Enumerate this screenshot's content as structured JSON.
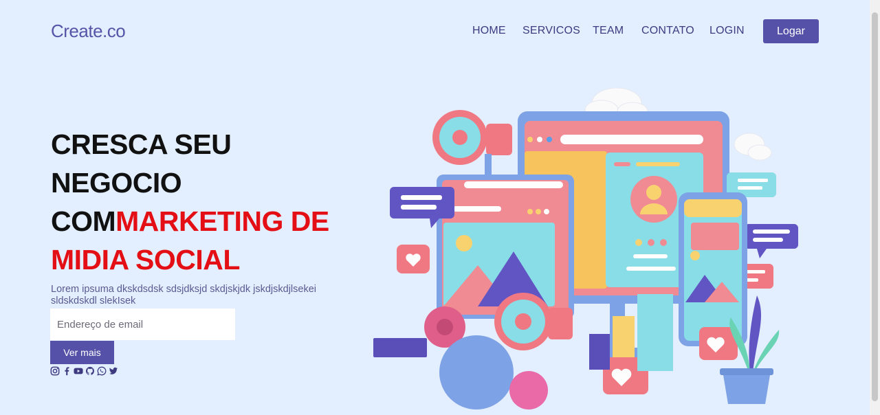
{
  "brand": {
    "logo": "Create.co"
  },
  "nav": {
    "items": [
      {
        "label": "HOME"
      },
      {
        "label": "SERVICOS"
      },
      {
        "label": "TEAM"
      },
      {
        "label": "CONTATO"
      },
      {
        "label": "LOGIN"
      }
    ],
    "login_button": "Logar"
  },
  "hero": {
    "title_line1": "CRESCA SEU",
    "title_line2": "NEGOCIO",
    "title_line3_black": "COM",
    "title_line3_red": "MARKETING DE",
    "title_line4_red": "MIDIA SOCIAL",
    "description": "Lorem ipsuma dkskdsdsk sdsjdksjd skdjskjdk jskdjskdjlsekei sldskdskdl slekIsek",
    "email_placeholder": "Endereço de email",
    "cta_button": "Ver mais",
    "accent_color": "#e40e15"
  },
  "socials": [
    "instagram-icon",
    "facebook-icon",
    "youtube-icon",
    "github-icon",
    "whatsapp-icon",
    "twitter-icon"
  ],
  "colors": {
    "primary": "#5551a8",
    "background": "#e3efff",
    "nav_text": "#3d3a80"
  }
}
